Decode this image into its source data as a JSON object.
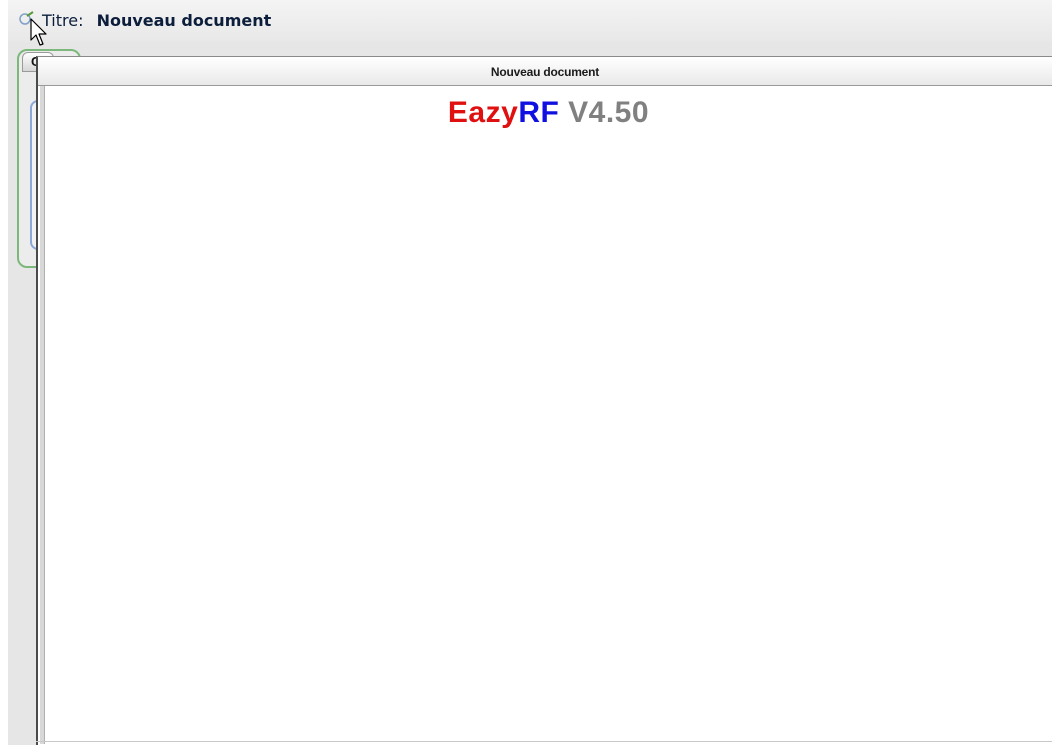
{
  "header": {
    "title_key": "Titre:",
    "title_value": "Nouveau document",
    "icon": "document-settings-icon"
  },
  "background_panel": {
    "tab_label": "C"
  },
  "document": {
    "window_title": "Nouveau document",
    "logo": {
      "part1": "Eazy",
      "part2": "RF",
      "part3": "V4.50"
    }
  },
  "colors": {
    "logo_red": "#e01010",
    "logo_blue": "#1010e0",
    "logo_gray": "#808080",
    "group_border": "#7cb87c"
  }
}
